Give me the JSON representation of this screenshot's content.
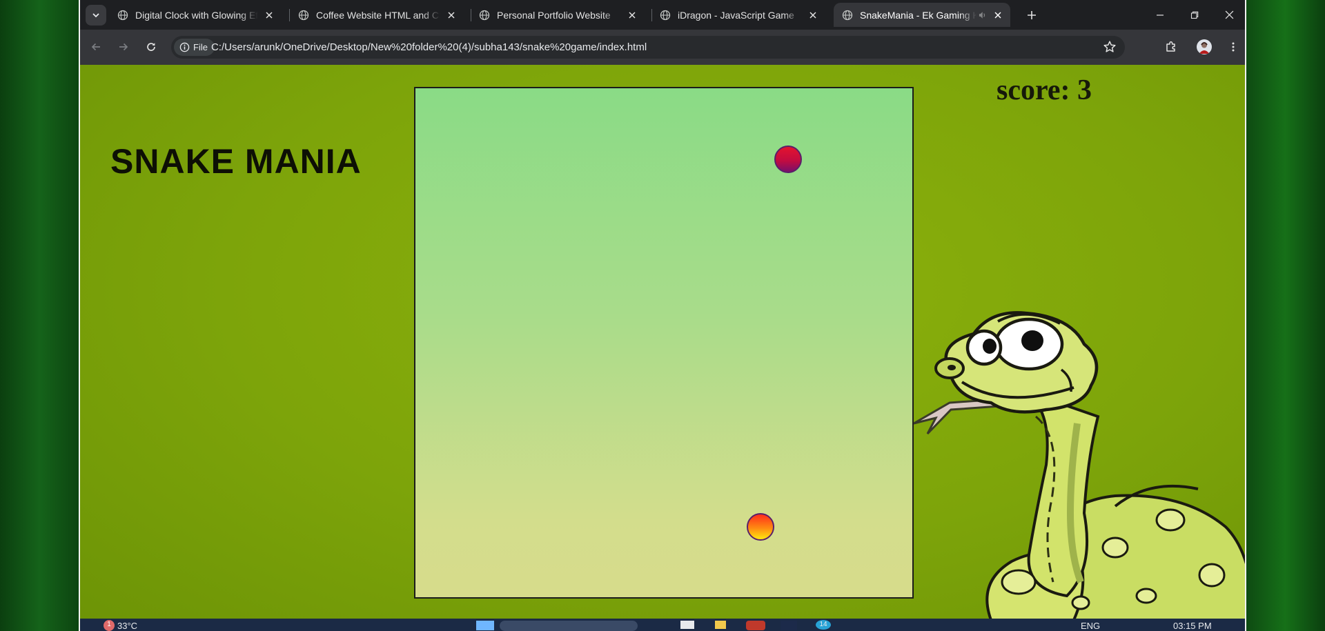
{
  "browser": {
    "tabs": [
      {
        "title": "Digital Clock with Glowing Effect",
        "active": false
      },
      {
        "title": "Coffee Website HTML and CSS | ",
        "active": false
      },
      {
        "title": "Personal Portfolio Website",
        "active": false
      },
      {
        "title": "iDragon - JavaScript Game",
        "active": false
      },
      {
        "title": "SnakeMania - Ek Gaming Ki",
        "active": true
      }
    ],
    "omnibox": {
      "chip_label": "File",
      "url": "C:/Users/arunk/OneDrive/Desktop/New%20folder%20(4)/subha143/snake%20game/index.html"
    }
  },
  "page": {
    "heading": "SNAKE MANIA",
    "score_label": "score: 3"
  },
  "game": {
    "grid_size": 18,
    "snake": [
      {
        "x": 14,
        "y": 3
      }
    ],
    "food": {
      "x": 13,
      "y": 16
    },
    "colors": {
      "snake_head": "#e3132e",
      "food": "#ffb812",
      "board_top": "#8adb86",
      "board_bottom": "#d7dc8b",
      "page_bg": "#7da40a"
    }
  },
  "taskbar": {
    "weather": "33°C",
    "weather_badge": "1",
    "language": "ENG",
    "clock": "03:15 PM",
    "notification_count": "14"
  }
}
